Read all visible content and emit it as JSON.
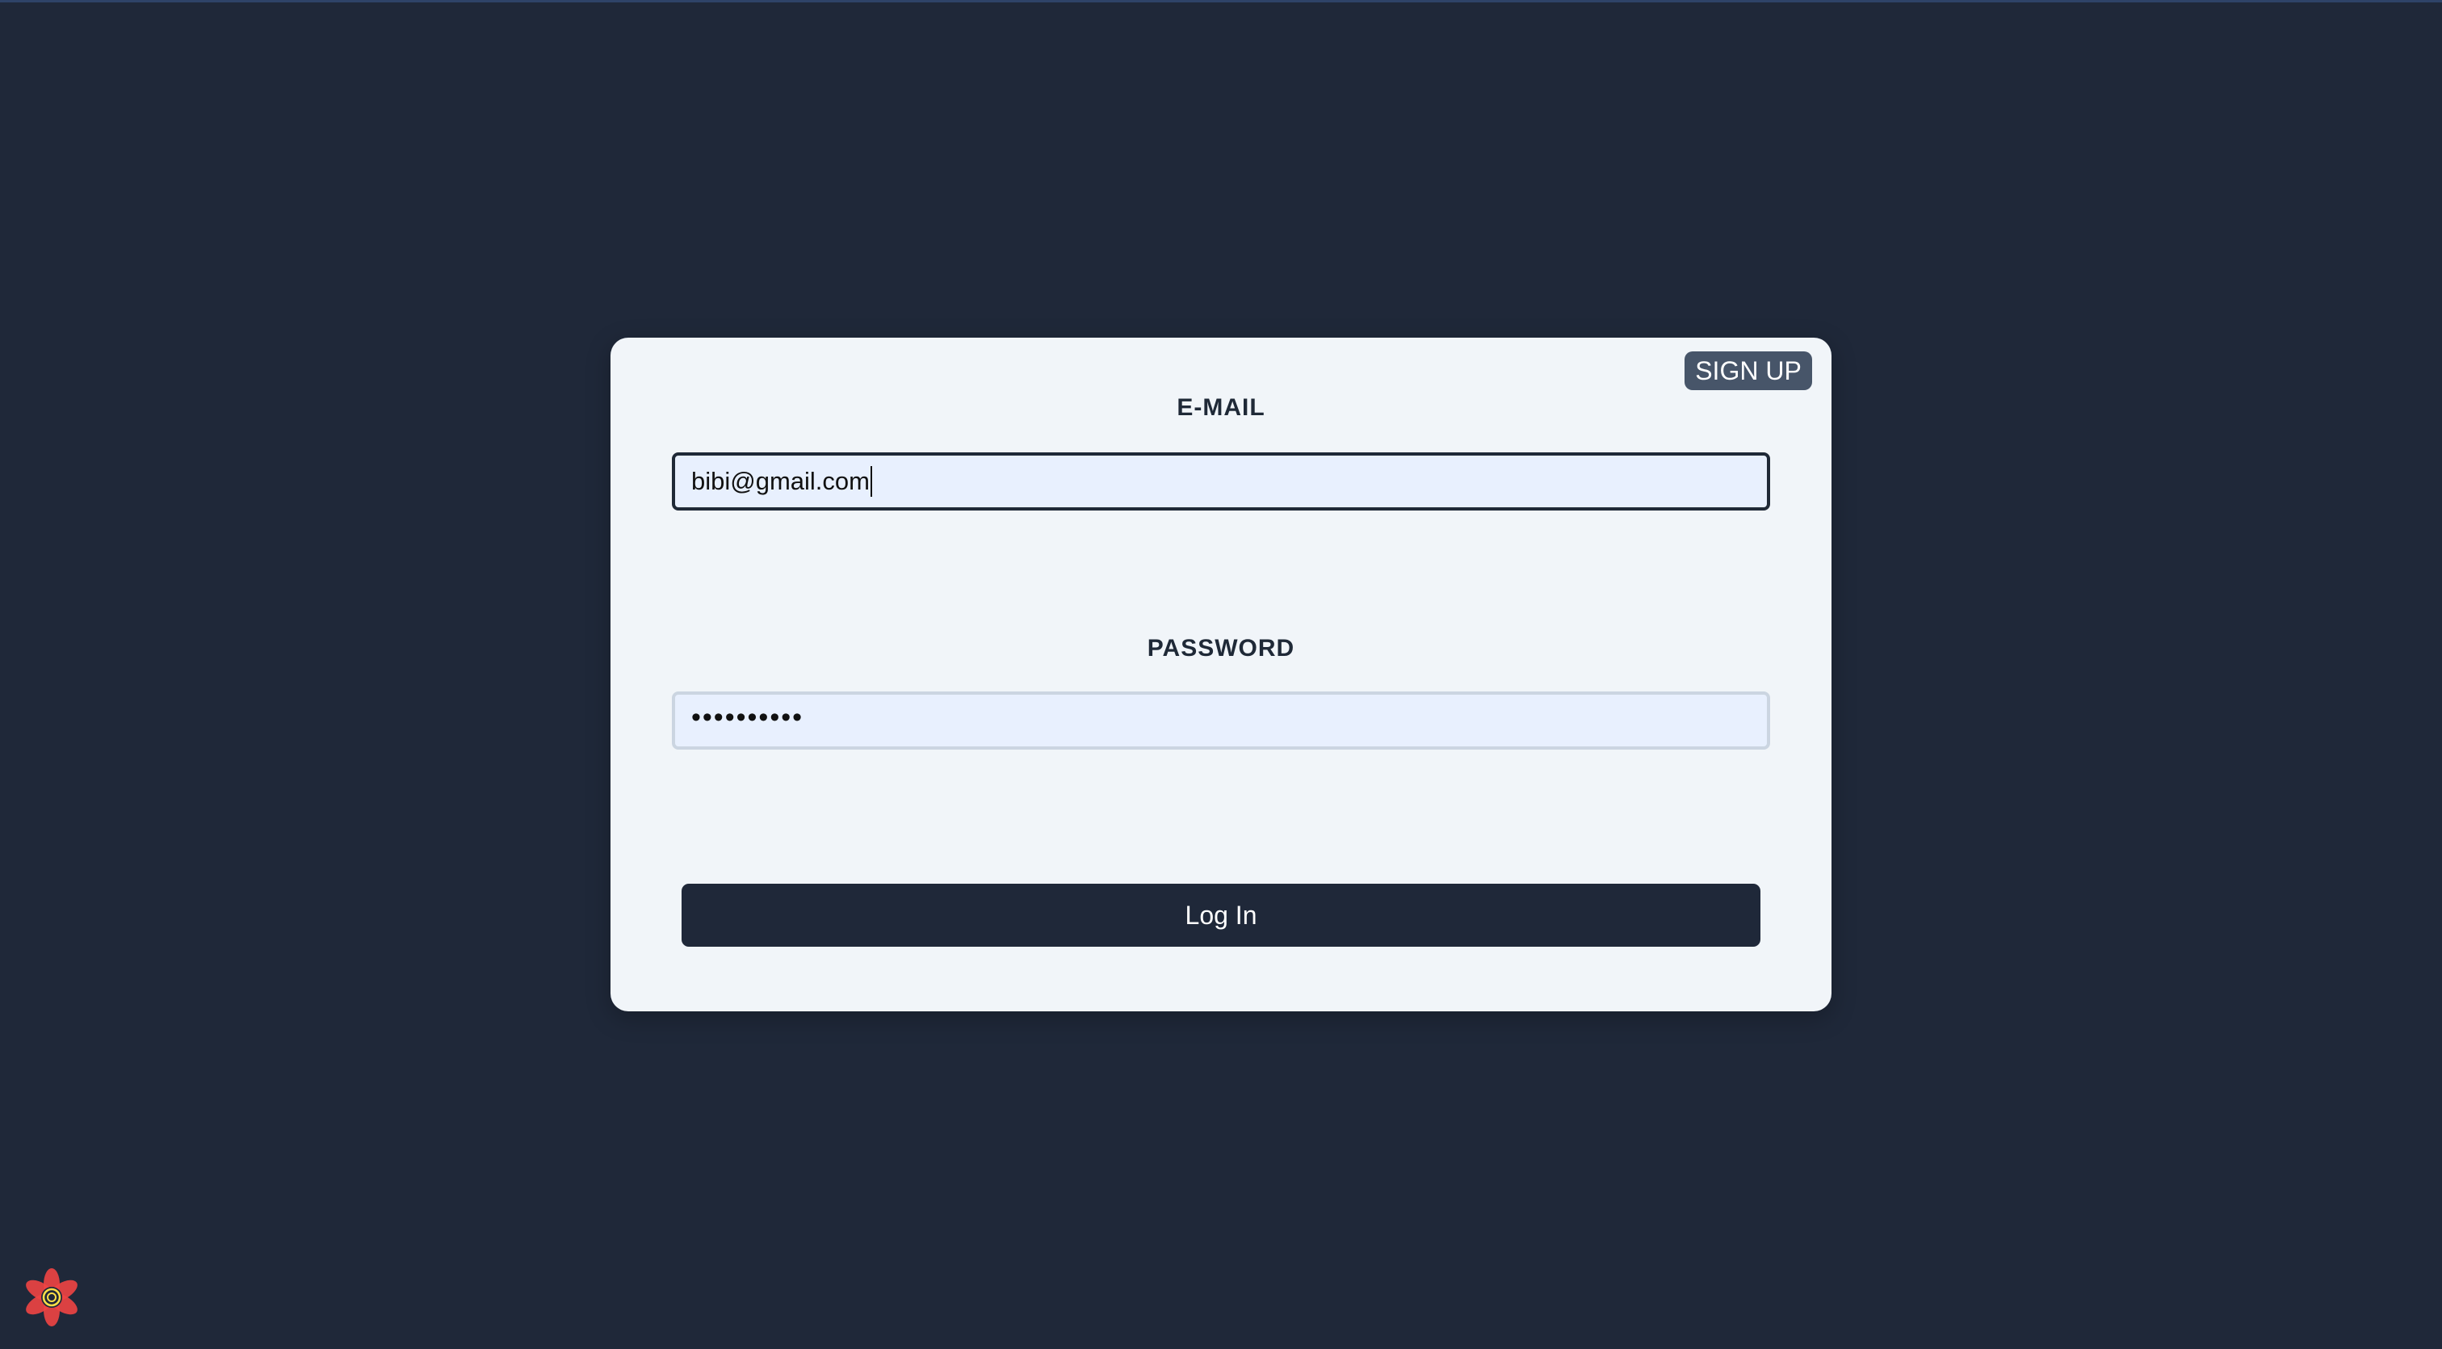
{
  "auth_card": {
    "signup_label": "SIGN UP",
    "email": {
      "label": "E-MAIL",
      "value": "bibi@gmail.com"
    },
    "password": {
      "label": "PASSWORD",
      "masked_value": "••••••••••"
    },
    "login_label": "Log In"
  },
  "devtools": {
    "icon": "react-query-devtools-flower-icon"
  },
  "colors": {
    "background": "#1f2839",
    "card": "#f1f5f9",
    "signup_button": "#475569",
    "login_button": "#1f2839",
    "input_fill": "#e8f0fe"
  }
}
